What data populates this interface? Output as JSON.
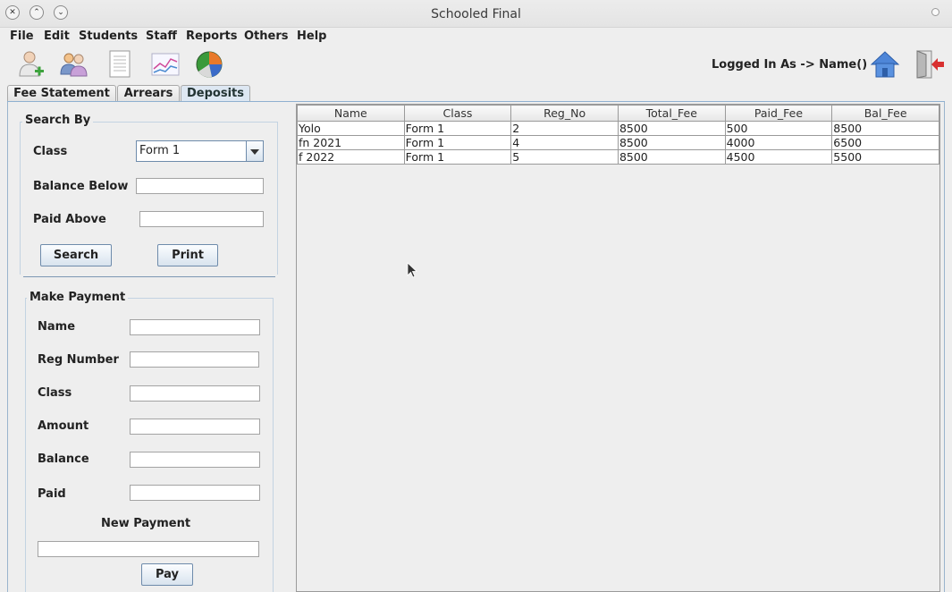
{
  "window": {
    "title": "Schooled Final"
  },
  "menu": [
    "File",
    "Edit",
    "Students",
    "Staff",
    "Reports",
    "Others",
    "Help"
  ],
  "toolbar": {
    "icons": [
      "add-student-icon",
      "staff-group-icon",
      "document-icon",
      "chart-icon",
      "pie-chart-icon",
      "home-icon",
      "exit-icon"
    ],
    "logged_in_label": "Logged In As -> Name()"
  },
  "tabs": [
    "Fee Statement",
    "Arrears",
    "Deposits"
  ],
  "active_tab": "Deposits",
  "search": {
    "title": "Search By",
    "class_label": "Class",
    "class_value": "Form 1",
    "balance_below_label": "Balance Below",
    "balance_below_value": "",
    "paid_above_label": "Paid Above",
    "paid_above_value": "",
    "search_button": "Search",
    "print_button": "Print"
  },
  "payment": {
    "title": "Make Payment",
    "name_label": "Name",
    "reg_label": "Reg Number",
    "class_label": "Class",
    "amount_label": "Amount",
    "balance_label": "Balance",
    "paid_label": "Paid",
    "new_payment_label": "New Payment",
    "pay_button": "Pay"
  },
  "table": {
    "columns": [
      "Name",
      "Class",
      "Reg_No",
      "Total_Fee",
      "Paid_Fee",
      "Bal_Fee"
    ],
    "rows": [
      [
        "Yolo",
        "Form 1",
        "2",
        "8500",
        "500",
        "8500"
      ],
      [
        "fn 2021",
        "Form 1",
        "4",
        "8500",
        "4000",
        "6500"
      ],
      [
        "f 2022",
        "Form 1",
        "5",
        "8500",
        "4500",
        "5500"
      ]
    ]
  },
  "colors": {
    "tab_active": "#dde7f2",
    "panel_border": "#9ab4cd",
    "background": "#eeeeee"
  }
}
